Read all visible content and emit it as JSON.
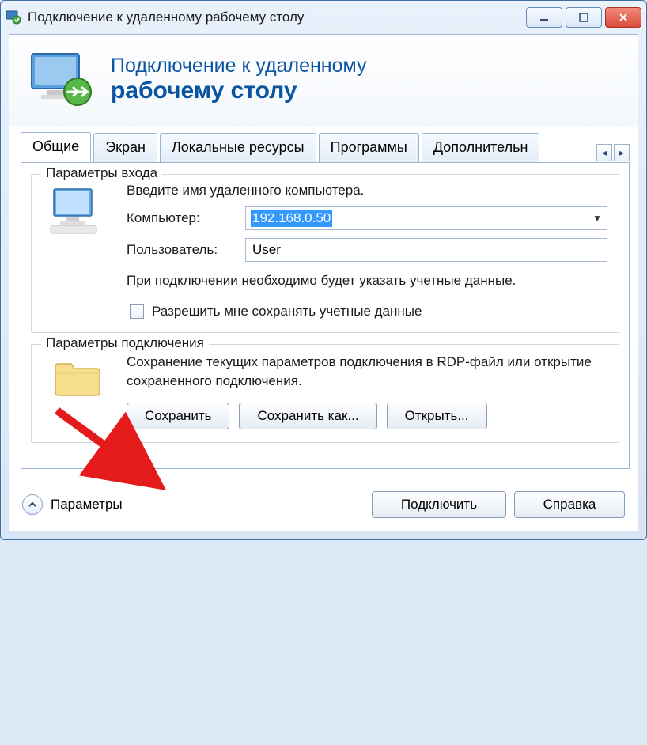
{
  "titlebar": {
    "text": "Подключение к удаленному рабочему столу"
  },
  "header": {
    "line1": "Подключение к удаленному",
    "line2": "рабочему столу"
  },
  "tabs": {
    "items": [
      "Общие",
      "Экран",
      "Локальные ресурсы",
      "Программы",
      "Дополнительн"
    ],
    "active_index": 0
  },
  "login_group": {
    "legend": "Параметры входа",
    "intro": "Введите имя удаленного компьютера.",
    "computer_label": "Компьютер:",
    "computer_value": "192.168.0.50",
    "user_label": "Пользователь:",
    "user_value": "User",
    "credentials_info": "При подключении необходимо будет указать учетные данные.",
    "save_creds_label": "Разрешить мне сохранять учетные данные",
    "save_creds_checked": false
  },
  "conn_group": {
    "legend": "Параметры подключения",
    "desc": "Сохранение текущих параметров подключения в RDP-файл или открытие сохраненного подключения.",
    "save_btn": "Сохранить",
    "save_as_btn": "Сохранить как...",
    "open_btn": "Открыть..."
  },
  "footer": {
    "params_label": "Параметры",
    "connect_btn": "Подключить",
    "help_btn": "Справка"
  }
}
